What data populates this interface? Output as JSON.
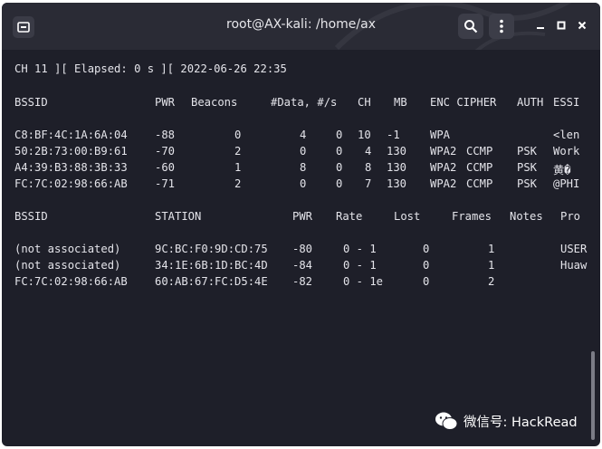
{
  "window": {
    "title": "root@AX-kali: /home/ax"
  },
  "icons": {
    "app": "terminal-tab-icon",
    "search": "search-icon",
    "menu": "kebab-menu-icon",
    "minimize": "minimize-icon",
    "maximize": "maximize-icon",
    "close": "close-icon"
  },
  "terminal": {
    "status_line": "CH 11 ][ Elapsed: 0 s ][ 2022-06-26 22:35",
    "ap_headers": [
      "BSSID",
      "PWR",
      "Beacons",
      "#Data, #/s",
      "CH",
      "MB",
      "ENC CIPHER",
      "AUTH",
      "ESSI"
    ],
    "ap_rows": [
      [
        "C8:BF:4C:1A:6A:04",
        "-88",
        "0",
        "4",
        "0",
        "10",
        "-1",
        "WPA",
        "",
        "",
        "<len"
      ],
      [
        "50:2B:73:00:B9:61",
        "-70",
        "2",
        "0",
        "0",
        "4",
        "130",
        "WPA2",
        "CCMP",
        "PSK",
        "Work"
      ],
      [
        "A4:39:B3:88:3B:33",
        "-60",
        "1",
        "8",
        "0",
        "8",
        "130",
        "WPA2",
        "CCMP",
        "PSK",
        "黄�"
      ],
      [
        "FC:7C:02:98:66:AB",
        "-71",
        "2",
        "0",
        "0",
        "7",
        "130",
        "WPA2",
        "CCMP",
        "PSK",
        "@PHI"
      ]
    ],
    "sta_headers": [
      "BSSID",
      "STATION",
      "PWR",
      "Rate",
      "Lost",
      "Frames",
      "Notes",
      "Pro"
    ],
    "sta_rows": [
      [
        "(not associated)",
        "9C:BC:F0:9D:CD:75",
        "-80",
        "0 - 1",
        "0",
        "1",
        "USER"
      ],
      [
        "(not associated)",
        "34:1E:6B:1D:BC:4D",
        "-84",
        "0 - 1",
        "0",
        "1",
        "Huaw"
      ],
      [
        "FC:7C:02:98:66:AB",
        "60:AB:67:FC:D5:4E",
        "-82",
        "0 - 1e",
        "0",
        "2",
        ""
      ]
    ]
  },
  "watermark": {
    "text": "微信号: HackRead"
  },
  "colors": {
    "background": "#1e1f29",
    "titlebar": "#2a2b35",
    "text": "#e4e4ea"
  }
}
